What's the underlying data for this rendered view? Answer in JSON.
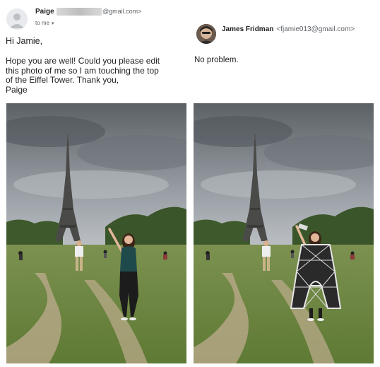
{
  "email": {
    "sender": {
      "name": "Paige",
      "email_suffix": "@gmail.com>",
      "to_line": "to me",
      "caret": "▾"
    },
    "message": {
      "greeting": "Hi Jamie,",
      "body": "Hope you are well! Could you please edit\nthis photo of me so I am touching the top\nof the Eiffel Tower. Thank you,\nPaige"
    },
    "reply": {
      "name": "James Fridman",
      "email": "<fjamie013@gmail.com>",
      "text": "No problem."
    }
  },
  "photos": {
    "original": {
      "icon": "eiffel-tower-photo"
    },
    "edited": {
      "icon": "eiffel-tower-costume-photo"
    }
  },
  "colors": {
    "sky": "#c9ced3",
    "grass": "#6f8a3d",
    "path": "#b9a98a",
    "trees": "#3e5a2c",
    "tower": "#4a4a48"
  }
}
